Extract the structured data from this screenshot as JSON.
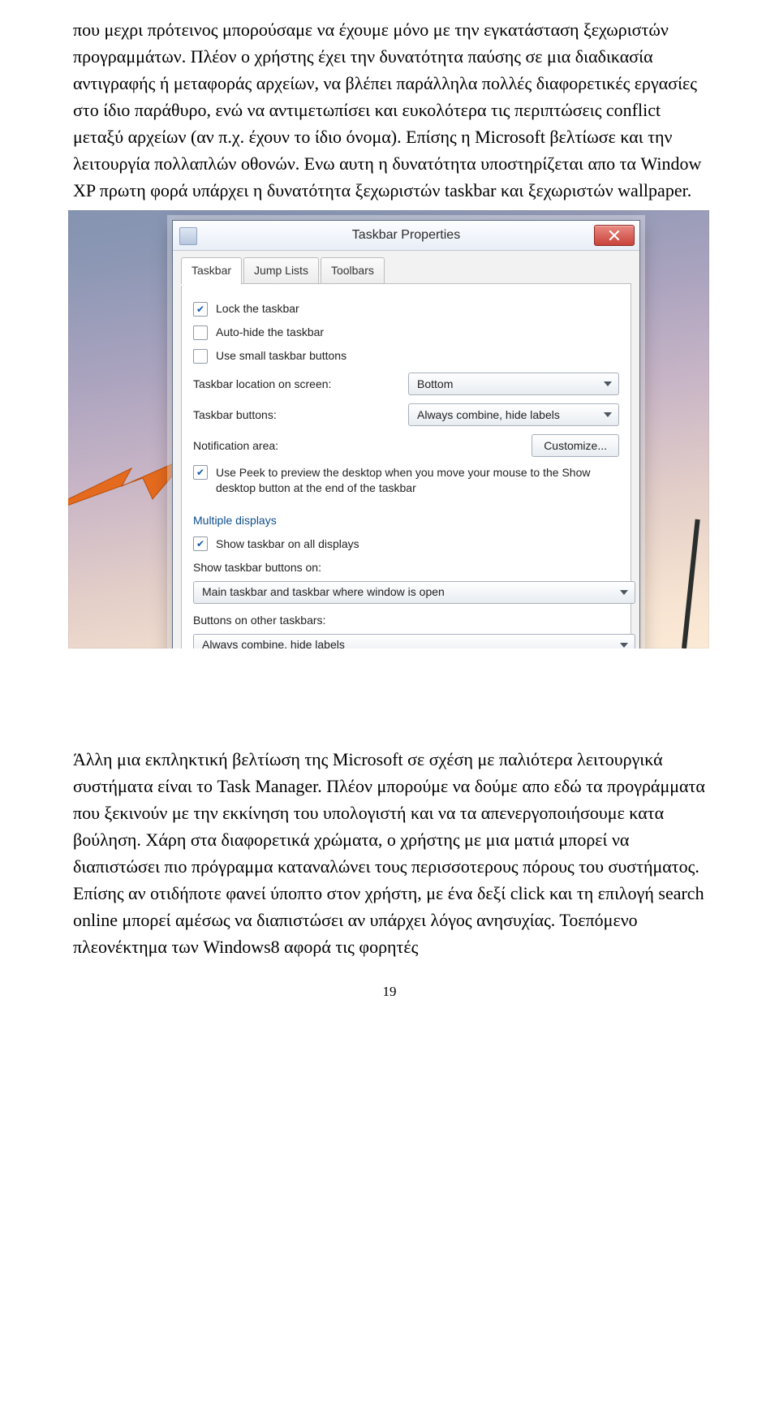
{
  "para1": "που μεχρι πρότεινος μπορούσαμε να έχουμε μόνο με την εγκατάσταση ξεχωριστών προγραμμάτων. Πλέον ο χρήστης έχει την δυνατότητα παύσης σε μια διαδικασία αντιγραφής ή μεταφοράς αρχείων, να βλέπει παράλληλα πολλές διαφορετικές εργασίες στο ίδιο παράθυρο, ενώ να αντιμετωπίσει και ευκολότερα τις περιπτώσεις conflict μεταξύ αρχείων (αν π.χ. έχουν το ίδιο όνομα). Επίσης η Microsoft βελτίωσε και την λειτουργία πολλαπλών οθονών. Ενω αυτη η δυνατότητα υποστηρίζεται απο τα Window XP πρωτη φορά υπάρχει η δυνατότητα ξεχωριστών taskbar και ξεχωριστών wallpaper.",
  "para2": "Άλλη μια εκπληκτική βελτίωση της Microsoft  σε σχέση με παλιότερα λειτουργικά συστήματα είναι το Task Manager. Πλέον μπορούμε να δούμε απο εδώ τα προγράμματα που ξεκινούν με την εκκίνηση του υπολογιστή και να τα απενεργοποιήσουμε κατα βούληση. Χάρη στα διαφορετικά χρώματα, ο χρήστης με μια ματιά μπορεί να διαπιστώσει πιο πρόγραμμα καταναλώνει τους περισσοτερους πόρους του συστήματος. Επίσης αν οτιδήποτε φανεί ύποπτο στον χρήστη, με ένα δεξί click και τη επιλογή search online μπορεί αμέσως να διαπιστώσει αν υπάρχει λόγος ανησυχίας. Τοεπόμενο πλεονέκτημα των Windows8 αφορά τις φορητές",
  "pageNumber": "19",
  "dialog": {
    "title": "Taskbar Properties",
    "tabs": [
      "Taskbar",
      "Jump Lists",
      "Toolbars"
    ],
    "lockTaskbar": "Lock the taskbar",
    "autoHide": "Auto-hide the taskbar",
    "smallButtons": "Use small taskbar buttons",
    "locationLabel": "Taskbar location on screen:",
    "locationValue": "Bottom",
    "buttonsLabel": "Taskbar buttons:",
    "buttonsValue": "Always combine, hide labels",
    "notifLabel": "Notification area:",
    "notifButton": "Customize...",
    "peekText": "Use Peek to preview the desktop when you move your mouse to the Show desktop button at the end of the taskbar",
    "multiLegend": "Multiple displays",
    "showAll": "Show taskbar on all displays",
    "showOnLabel": "Show taskbar buttons on:",
    "showOnValue": "Main taskbar and taskbar where window is open",
    "otherLabel": "Buttons on other taskbars:",
    "otherValue": "Always combine, hide labels"
  }
}
